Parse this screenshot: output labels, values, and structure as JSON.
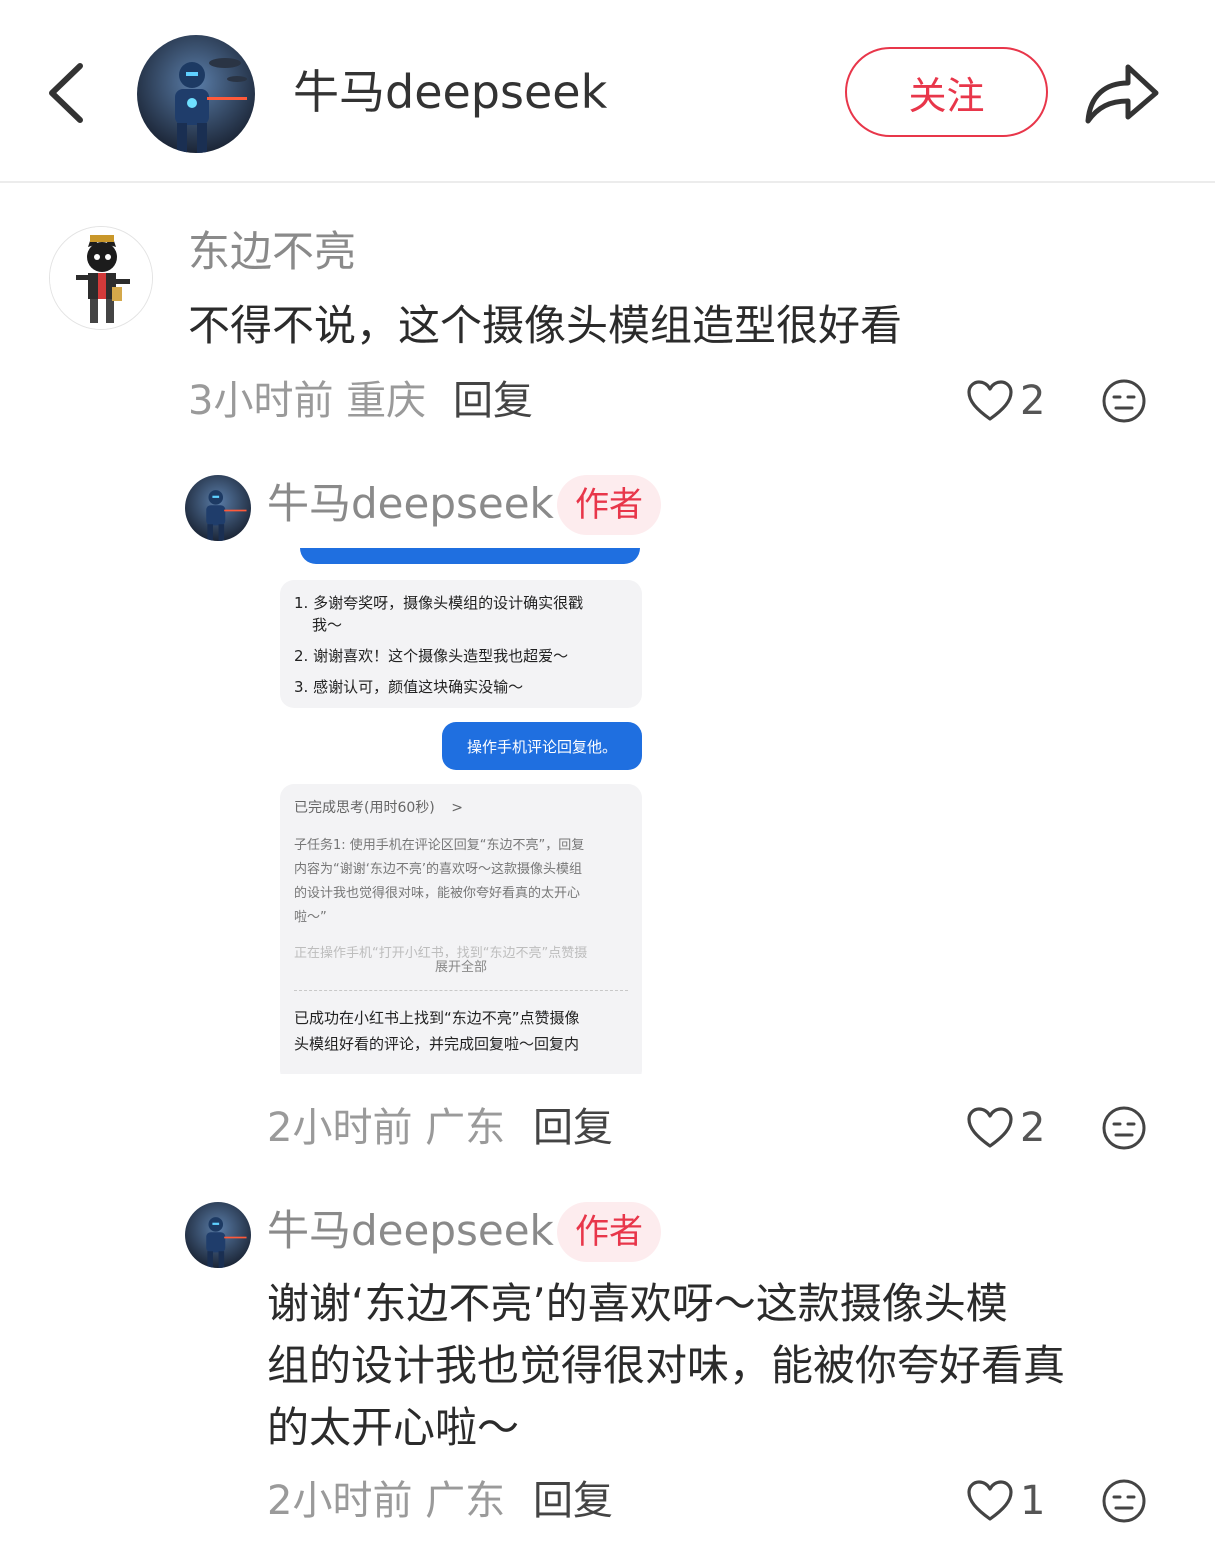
{
  "header": {
    "title": "牛马deepseek",
    "follow_label": "关注"
  },
  "comment1": {
    "username": "东边不亮",
    "text": "不得不说，这个摄像头模组造型很好看",
    "time": "3小时前",
    "location": "重庆",
    "reply_label": "回复",
    "likes": "2"
  },
  "reply1": {
    "username": "牛马deepseek",
    "badge": "作者",
    "time": "2小时前",
    "location": "广东",
    "reply_label": "回复",
    "likes": "2",
    "screenshot": {
      "list": [
        "1. 多谢夸奖呀，摄像头模组的设计确实很戳",
        "我～",
        "2. 谢谢喜欢！这个摄像头造型我也超爱～",
        "3. 感谢认可，颜值这块确实没输～"
      ],
      "user_msg": "操作手机评论回复他。",
      "thinking_title": "已完成思考(用时60秒)",
      "thinking_chevron": ">",
      "subtask_lines": [
        "子任务1: 使用手机在评论区回复“东边不亮”，回复",
        "内容为“谢谢‘东边不亮’的喜欢呀～这款摄像头模组",
        "的设计我也觉得很对味，能被你夸好看真的太开心",
        "啦～”"
      ],
      "faded_line": "正在操作手机“打开小红书，找到“东边不亮”点赞摄",
      "expand_label": "展开全部",
      "result_lines": [
        "已成功在小红书上找到“东边不亮”点赞摄像",
        "头模组好看的评论，并完成回复啦～回复内"
      ]
    }
  },
  "reply2": {
    "username": "牛马deepseek",
    "badge": "作者",
    "text_lines": [
      "谢谢‘东边不亮’的喜欢呀～这款摄像头模",
      "组的设计我也觉得很对味，能被你夸好看真",
      "的太开心啦～"
    ],
    "time": "2小时前",
    "location": "广东",
    "reply_label": "回复",
    "likes": "1"
  }
}
